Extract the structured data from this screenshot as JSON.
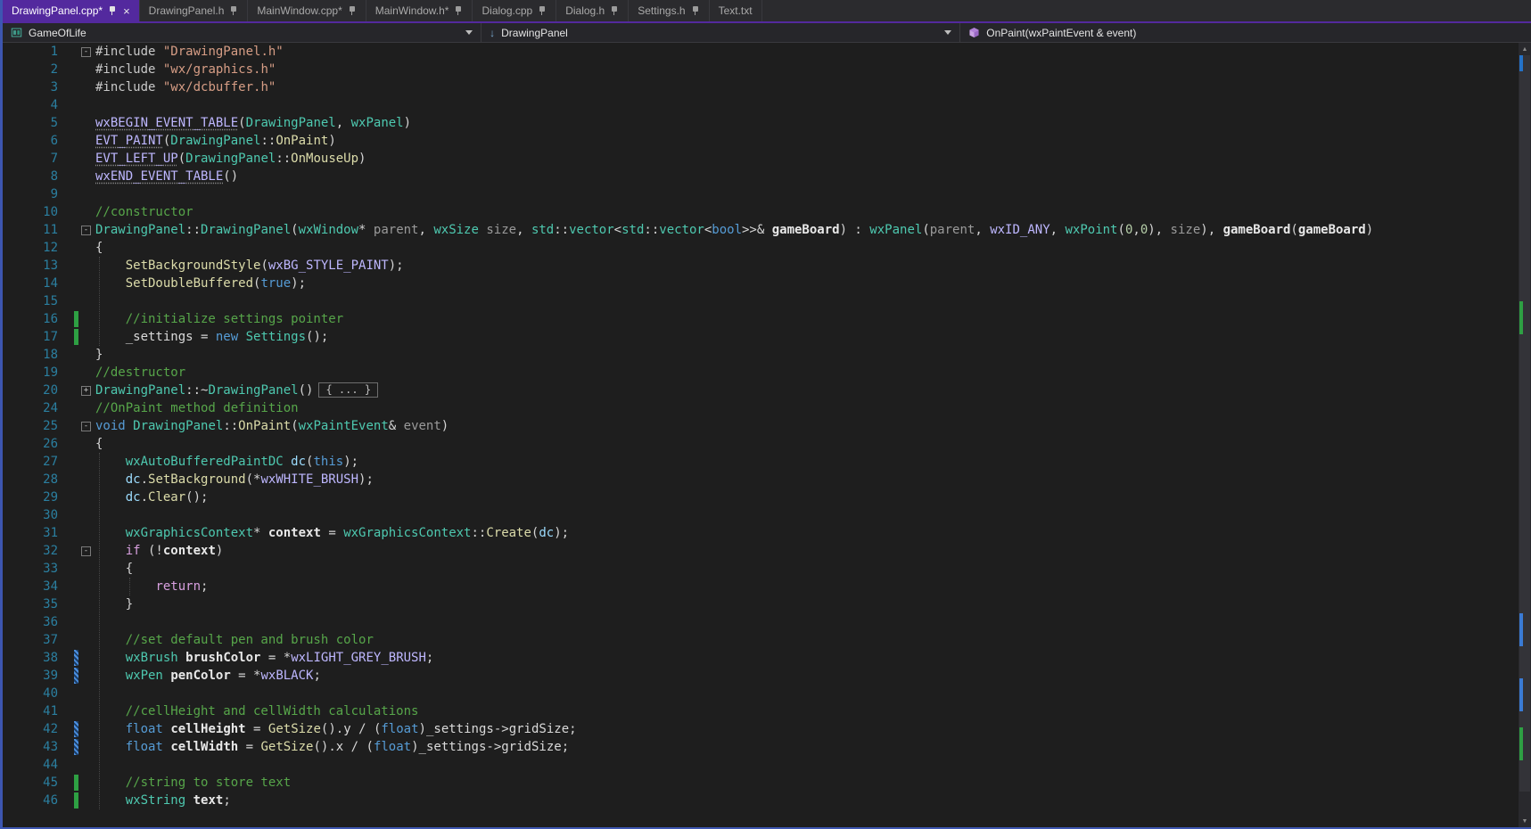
{
  "window": {
    "accent": "#53299e",
    "border_color": "#3d56b0"
  },
  "tabs": [
    {
      "label": "DrawingPanel.cpp*",
      "pinned": true,
      "active": true,
      "closable": true
    },
    {
      "label": "DrawingPanel.h",
      "pinned": true,
      "active": false,
      "closable": false
    },
    {
      "label": "MainWindow.cpp*",
      "pinned": true,
      "active": false,
      "closable": false
    },
    {
      "label": "MainWindow.h*",
      "pinned": true,
      "active": false,
      "closable": false
    },
    {
      "label": "Dialog.cpp",
      "pinned": true,
      "active": false,
      "closable": false
    },
    {
      "label": "Dialog.h",
      "pinned": true,
      "active": false,
      "closable": false
    },
    {
      "label": "Settings.h",
      "pinned": true,
      "active": false,
      "closable": false
    },
    {
      "label": "Text.txt",
      "pinned": false,
      "active": false,
      "closable": false
    }
  ],
  "navbar": {
    "project": "GameOfLife",
    "type": "DrawingPanel",
    "member": "OnPaint(wxPaintEvent & event)",
    "icons": {
      "project": "cpp-project-icon",
      "type": "down-arrow-icon",
      "member": "method-cube-icon",
      "dropdown": "chevron-down-icon"
    }
  },
  "editor": {
    "collapsed_text": "{ ... }",
    "indent_guides": [
      {
        "from": 13,
        "to": 17,
        "col": 0
      },
      {
        "from": 27,
        "to": 46,
        "col": 0
      },
      {
        "from": 34,
        "to": 34,
        "col": 1
      }
    ],
    "lines": [
      {
        "n": 1,
        "fold": "open",
        "t": [
          [
            "pp",
            "#include"
          ],
          [
            "n",
            " "
          ],
          [
            "str",
            "\"DrawingPanel.h\""
          ]
        ]
      },
      {
        "n": 2,
        "t": [
          [
            "pp",
            "#include"
          ],
          [
            "n",
            " "
          ],
          [
            "str",
            "\"wx/graphics.h\""
          ]
        ]
      },
      {
        "n": 3,
        "t": [
          [
            "pp",
            "#include"
          ],
          [
            "n",
            " "
          ],
          [
            "str",
            "\"wx/dcbuffer.h\""
          ]
        ]
      },
      {
        "n": 4,
        "t": []
      },
      {
        "n": 5,
        "t": [
          [
            "macu",
            "wxBEGIN_EVENT_TABLE"
          ],
          [
            "n",
            "("
          ],
          [
            "ty",
            "DrawingPanel"
          ],
          [
            "n",
            ", "
          ],
          [
            "ty",
            "wxPanel"
          ],
          [
            "n",
            ")"
          ]
        ]
      },
      {
        "n": 6,
        "t": [
          [
            "macu",
            "EVT_PAINT"
          ],
          [
            "n",
            "("
          ],
          [
            "ty",
            "DrawingPanel"
          ],
          [
            "n",
            "::"
          ],
          [
            "fn",
            "OnPaint"
          ],
          [
            "n",
            ")"
          ]
        ]
      },
      {
        "n": 7,
        "t": [
          [
            "macu",
            "EVT_LEFT_UP"
          ],
          [
            "n",
            "("
          ],
          [
            "ty",
            "DrawingPanel"
          ],
          [
            "n",
            "::"
          ],
          [
            "fn",
            "OnMouseUp"
          ],
          [
            "n",
            ")"
          ]
        ]
      },
      {
        "n": 8,
        "t": [
          [
            "macu",
            "wxEND_EVENT_TABLE"
          ],
          [
            "n",
            "()"
          ]
        ]
      },
      {
        "n": 9,
        "t": []
      },
      {
        "n": 10,
        "t": [
          [
            "com",
            "//constructor"
          ]
        ]
      },
      {
        "n": 11,
        "fold": "open",
        "t": [
          [
            "ty",
            "DrawingPanel"
          ],
          [
            "n",
            "::"
          ],
          [
            "ty",
            "DrawingPanel"
          ],
          [
            "n",
            "("
          ],
          [
            "ty",
            "wxWindow"
          ],
          [
            "n",
            "* "
          ],
          [
            "prm",
            "parent"
          ],
          [
            "n",
            ", "
          ],
          [
            "ty",
            "wxSize"
          ],
          [
            "n",
            " "
          ],
          [
            "prm",
            "size"
          ],
          [
            "n",
            ", "
          ],
          [
            "ty",
            "std"
          ],
          [
            "n",
            "::"
          ],
          [
            "ty",
            "vector"
          ],
          [
            "n",
            "<"
          ],
          [
            "ty",
            "std"
          ],
          [
            "n",
            "::"
          ],
          [
            "ty",
            "vector"
          ],
          [
            "n",
            "<"
          ],
          [
            "k",
            "bool"
          ],
          [
            "n",
            ">>& "
          ],
          [
            "var",
            "gameBoard"
          ],
          [
            "n",
            ") : "
          ],
          [
            "ty",
            "wxPanel"
          ],
          [
            "n",
            "("
          ],
          [
            "prm",
            "parent"
          ],
          [
            "n",
            ", "
          ],
          [
            "mac",
            "wxID_ANY"
          ],
          [
            "n",
            ", "
          ],
          [
            "ty",
            "wxPoint"
          ],
          [
            "n",
            "("
          ],
          [
            "num",
            "0"
          ],
          [
            "n",
            ","
          ],
          [
            "num",
            "0"
          ],
          [
            "n",
            "), "
          ],
          [
            "prm",
            "size"
          ],
          [
            "n",
            "), "
          ],
          [
            "var",
            "gameBoard"
          ],
          [
            "n",
            "("
          ],
          [
            "var",
            "gameBoard"
          ],
          [
            "n",
            ")"
          ]
        ]
      },
      {
        "n": 12,
        "t": [
          [
            "n",
            "{"
          ]
        ]
      },
      {
        "n": 13,
        "t": [
          [
            "n",
            "    "
          ],
          [
            "fn",
            "SetBackgroundStyle"
          ],
          [
            "n",
            "("
          ],
          [
            "mac",
            "wxBG_STYLE_PAINT"
          ],
          [
            "n",
            ");"
          ]
        ]
      },
      {
        "n": 14,
        "t": [
          [
            "n",
            "    "
          ],
          [
            "fn",
            "SetDoubleBuffered"
          ],
          [
            "n",
            "("
          ],
          [
            "k",
            "true"
          ],
          [
            "n",
            ");"
          ]
        ]
      },
      {
        "n": 15,
        "t": []
      },
      {
        "n": 16,
        "bar": "saved",
        "t": [
          [
            "n",
            "    "
          ],
          [
            "com",
            "//initialize settings pointer"
          ]
        ]
      },
      {
        "n": 17,
        "bar": "saved",
        "t": [
          [
            "n",
            "    "
          ],
          [
            "fld",
            "_settings"
          ],
          [
            "n",
            " = "
          ],
          [
            "k",
            "new"
          ],
          [
            "n",
            " "
          ],
          [
            "ty",
            "Settings"
          ],
          [
            "n",
            "();"
          ]
        ]
      },
      {
        "n": 18,
        "t": [
          [
            "n",
            "}"
          ]
        ]
      },
      {
        "n": 19,
        "t": [
          [
            "com",
            "//destructor"
          ]
        ]
      },
      {
        "n": 20,
        "fold": "collapsed",
        "box": true,
        "t": [
          [
            "ty",
            "DrawingPanel"
          ],
          [
            "n",
            "::~"
          ],
          [
            "ty",
            "DrawingPanel"
          ],
          [
            "n",
            "()"
          ]
        ]
      },
      {
        "n": 24,
        "t": [
          [
            "com",
            "//OnPaint method definition"
          ]
        ]
      },
      {
        "n": 25,
        "fold": "open",
        "t": [
          [
            "k",
            "void"
          ],
          [
            "n",
            " "
          ],
          [
            "ty",
            "DrawingPanel"
          ],
          [
            "n",
            "::"
          ],
          [
            "fn",
            "OnPaint"
          ],
          [
            "n",
            "("
          ],
          [
            "ty",
            "wxPaintEvent"
          ],
          [
            "n",
            "& "
          ],
          [
            "prm",
            "event"
          ],
          [
            "n",
            ")"
          ]
        ]
      },
      {
        "n": 26,
        "t": [
          [
            "n",
            "{"
          ]
        ]
      },
      {
        "n": 27,
        "t": [
          [
            "n",
            "    "
          ],
          [
            "ty",
            "wxAutoBufferedPaintDC"
          ],
          [
            "n",
            " "
          ],
          [
            "loc",
            "dc"
          ],
          [
            "n",
            "("
          ],
          [
            "k",
            "this"
          ],
          [
            "n",
            ");"
          ]
        ]
      },
      {
        "n": 28,
        "t": [
          [
            "n",
            "    "
          ],
          [
            "loc",
            "dc"
          ],
          [
            "n",
            "."
          ],
          [
            "fn",
            "SetBackground"
          ],
          [
            "n",
            "(*"
          ],
          [
            "mac",
            "wxWHITE_BRUSH"
          ],
          [
            "n",
            ");"
          ]
        ]
      },
      {
        "n": 29,
        "t": [
          [
            "n",
            "    "
          ],
          [
            "loc",
            "dc"
          ],
          [
            "n",
            "."
          ],
          [
            "fn",
            "Clear"
          ],
          [
            "n",
            "();"
          ]
        ]
      },
      {
        "n": 30,
        "t": []
      },
      {
        "n": 31,
        "t": [
          [
            "n",
            "    "
          ],
          [
            "ty",
            "wxGraphicsContext"
          ],
          [
            "n",
            "* "
          ],
          [
            "var",
            "context"
          ],
          [
            "n",
            " = "
          ],
          [
            "ty",
            "wxGraphicsContext"
          ],
          [
            "n",
            "::"
          ],
          [
            "fn",
            "Create"
          ],
          [
            "n",
            "("
          ],
          [
            "loc",
            "dc"
          ],
          [
            "n",
            ");"
          ]
        ]
      },
      {
        "n": 32,
        "fold": "open",
        "t": [
          [
            "n",
            "    "
          ],
          [
            "kc",
            "if"
          ],
          [
            "n",
            " (!"
          ],
          [
            "var",
            "context"
          ],
          [
            "n",
            ")"
          ]
        ]
      },
      {
        "n": 33,
        "t": [
          [
            "n",
            "    {"
          ]
        ]
      },
      {
        "n": 34,
        "t": [
          [
            "n",
            "        "
          ],
          [
            "kc",
            "return"
          ],
          [
            "n",
            ";"
          ]
        ]
      },
      {
        "n": 35,
        "t": [
          [
            "n",
            "    }"
          ]
        ]
      },
      {
        "n": 36,
        "t": []
      },
      {
        "n": 37,
        "t": [
          [
            "n",
            "    "
          ],
          [
            "com",
            "//set default pen and brush color"
          ]
        ]
      },
      {
        "n": 38,
        "bar": "tracked",
        "t": [
          [
            "n",
            "    "
          ],
          [
            "ty",
            "wxBrush"
          ],
          [
            "n",
            " "
          ],
          [
            "var",
            "brushColor"
          ],
          [
            "n",
            " = *"
          ],
          [
            "mac",
            "wxLIGHT_GREY_BRUSH"
          ],
          [
            "n",
            ";"
          ]
        ]
      },
      {
        "n": 39,
        "bar": "tracked",
        "t": [
          [
            "n",
            "    "
          ],
          [
            "ty",
            "wxPen"
          ],
          [
            "n",
            " "
          ],
          [
            "var",
            "penColor"
          ],
          [
            "n",
            " = *"
          ],
          [
            "mac",
            "wxBLACK"
          ],
          [
            "n",
            ";"
          ]
        ]
      },
      {
        "n": 40,
        "t": []
      },
      {
        "n": 41,
        "t": [
          [
            "n",
            "    "
          ],
          [
            "com",
            "//cellHeight and cellWidth calculations"
          ]
        ]
      },
      {
        "n": 42,
        "bar": "tracked",
        "t": [
          [
            "n",
            "    "
          ],
          [
            "k",
            "float"
          ],
          [
            "n",
            " "
          ],
          [
            "var",
            "cellHeight"
          ],
          [
            "n",
            " = "
          ],
          [
            "fn",
            "GetSize"
          ],
          [
            "n",
            "()."
          ],
          [
            "fld",
            "y"
          ],
          [
            "n",
            " / ("
          ],
          [
            "k",
            "float"
          ],
          [
            "n",
            ")"
          ],
          [
            "fld",
            "_settings"
          ],
          [
            "n",
            "->"
          ],
          [
            "fld",
            "gridSize"
          ],
          [
            "n",
            ";"
          ]
        ]
      },
      {
        "n": 43,
        "bar": "tracked",
        "t": [
          [
            "n",
            "    "
          ],
          [
            "k",
            "float"
          ],
          [
            "n",
            " "
          ],
          [
            "var",
            "cellWidth"
          ],
          [
            "n",
            " = "
          ],
          [
            "fn",
            "GetSize"
          ],
          [
            "n",
            "()."
          ],
          [
            "fld",
            "x"
          ],
          [
            "n",
            " / ("
          ],
          [
            "k",
            "float"
          ],
          [
            "n",
            ")"
          ],
          [
            "fld",
            "_settings"
          ],
          [
            "n",
            "->"
          ],
          [
            "fld",
            "gridSize"
          ],
          [
            "n",
            ";"
          ]
        ]
      },
      {
        "n": 44,
        "t": []
      },
      {
        "n": 45,
        "bar": "saved",
        "t": [
          [
            "n",
            "    "
          ],
          [
            "com",
            "//string to store text"
          ]
        ]
      },
      {
        "n": 46,
        "bar": "saved",
        "t": [
          [
            "n",
            "    "
          ],
          [
            "ty",
            "wxString"
          ],
          [
            "n",
            " "
          ],
          [
            "var",
            "text"
          ],
          [
            "n",
            ";"
          ]
        ]
      }
    ]
  },
  "scrollbar": {
    "marks": [
      {
        "line": 1,
        "rows": 1,
        "color": "#2472c8"
      },
      {
        "line": 16,
        "rows": 2,
        "color": "#2ea043"
      },
      {
        "line": 38,
        "rows": 2,
        "color": "#3a7bd5"
      },
      {
        "line": 42,
        "rows": 2,
        "color": "#3a7bd5"
      },
      {
        "line": 45,
        "rows": 2,
        "color": "#2ea043"
      }
    ]
  },
  "syntax_colors": {
    "pp": "#c8c8c8",
    "k": "#569cd6",
    "kc": "#d8a0df",
    "str": "#d69d85",
    "com": "#57a64a",
    "ty": "#4ec9b0",
    "fn": "#dcdcaa",
    "mac": "#beb7ff",
    "macu": "#beb7ff",
    "n": "#d4d4d4",
    "prm": "#9a9a9a",
    "loc": "#9cdcfe",
    "var": "#e8e8e8",
    "fld": "#dadada",
    "num": "#b5cea8"
  },
  "ui_colors": {
    "accent": "#53299e",
    "border": "#3d56b0",
    "tab_bg": "#2b2b2e",
    "navbar_bg": "#26262a",
    "editor_bg": "#1e1e1e",
    "line_number": "#2b7fa0",
    "change_saved": "#2ea043",
    "change_tracked": "#3a7bd5"
  }
}
